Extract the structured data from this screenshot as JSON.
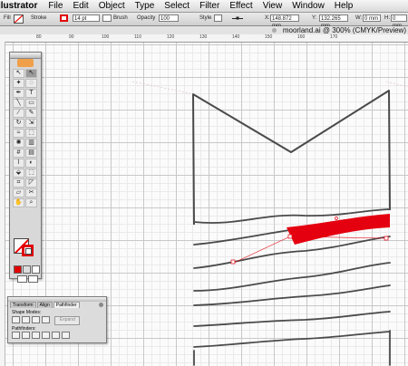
{
  "menubar": {
    "app_name": "llustrator",
    "items": [
      "File",
      "Edit",
      "Object",
      "Type",
      "Select",
      "Filter",
      "Effect",
      "View",
      "Window",
      "Help"
    ]
  },
  "control_bar": {
    "fill_label": "Fill",
    "stroke_label": "Stroke",
    "stroke_weight": "14 pt",
    "brush_value": "Brush",
    "opacity_label": "Opacity",
    "opacity_value": "100",
    "style_label": "Style",
    "x_label": "X:",
    "x_value": "148.872 mm",
    "y_label": "Y:",
    "y_value": "132.265 mm",
    "w_label": "W:",
    "w_value": "0 mm",
    "h_label": "H:",
    "h_value": "0 mm"
  },
  "document": {
    "title": "moorland.ai @ 300% (CMYK/Preview)"
  },
  "ruler": {
    "ticks": [
      "80",
      "90",
      "100",
      "110",
      "120",
      "130",
      "140",
      "150",
      "160",
      "170"
    ]
  },
  "path_panel": {
    "tabs": [
      "Transform",
      "Align",
      "Pathfinder"
    ],
    "shape_modes_label": "Shape Modes:",
    "expand_label": "Expand",
    "pathfinders_label": "Pathfinders:"
  },
  "colors": {
    "selection_red": "#e4000f",
    "stroke_red": "#e00000",
    "pencil_gray": "#4a4a4a"
  }
}
